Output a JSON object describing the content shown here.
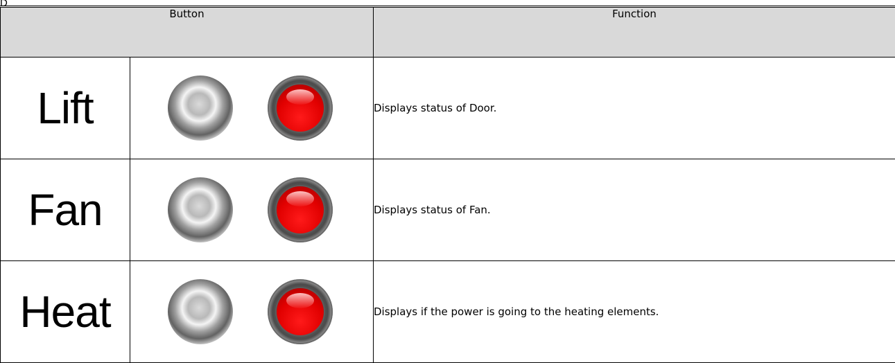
{
  "page_fragment": "D",
  "table": {
    "header": {
      "button": "Button",
      "function": "Function"
    },
    "rows": [
      {
        "name": "Lift",
        "function": "Displays status of Door.",
        "lamp_off": "indicator-off-icon",
        "lamp_on": "indicator-on-red-icon"
      },
      {
        "name": "Fan",
        "function": "Displays status of Fan.",
        "lamp_off": "indicator-off-icon",
        "lamp_on": "indicator-on-red-icon"
      },
      {
        "name": "Heat",
        "function": "Displays if the power is going to the heating elements.",
        "lamp_off": "indicator-off-icon",
        "lamp_on": "indicator-on-red-icon"
      }
    ]
  },
  "colors": {
    "header_bg": "#d9d9d9",
    "lamp_on": "#e10000",
    "lamp_off": "#9a9a9a"
  }
}
